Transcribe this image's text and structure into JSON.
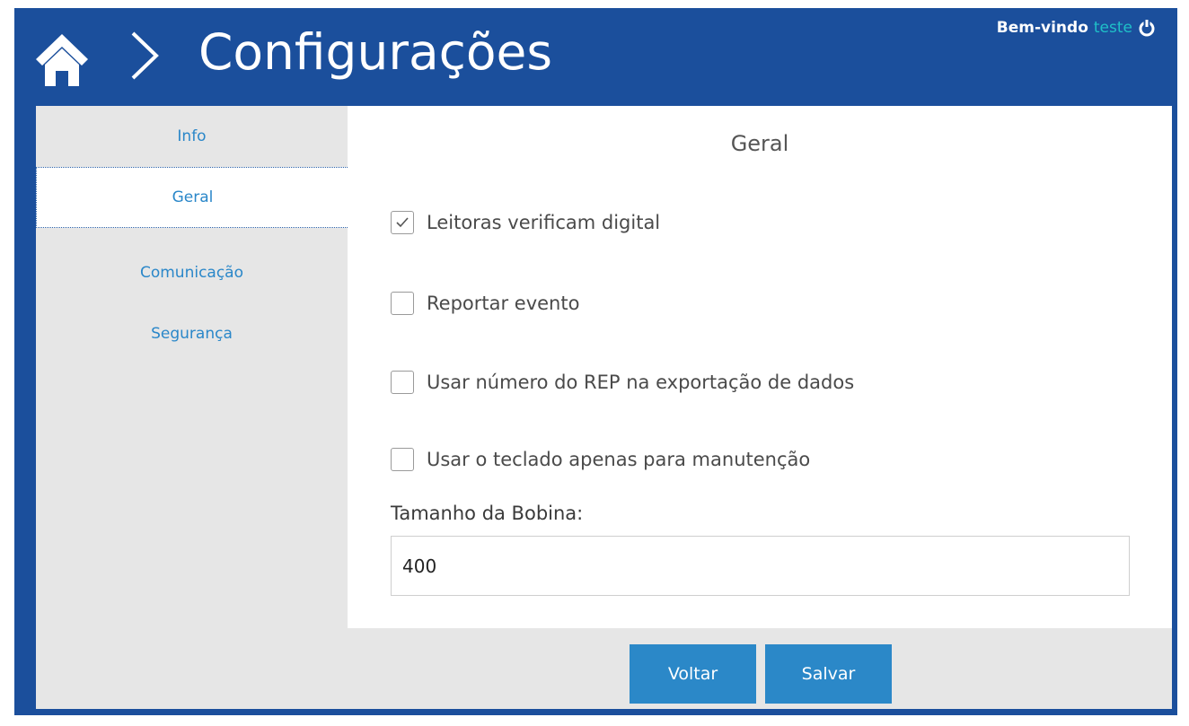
{
  "header": {
    "title": "Configurações",
    "home_icon": "home-icon",
    "separator_icon": "chevron-right-icon",
    "welcome_text": "Bem-vindo",
    "username": "teste",
    "logout_icon": "power-icon"
  },
  "sidebar": {
    "items": [
      {
        "label": "Info",
        "active": false
      },
      {
        "label": "Geral",
        "active": true
      },
      {
        "label": "Comunicação",
        "active": false
      },
      {
        "label": "Segurança",
        "active": false
      }
    ]
  },
  "main": {
    "section_title": "Geral",
    "options": [
      {
        "label": "Leitoras verificam digital",
        "checked": true
      },
      {
        "label": "Reportar evento",
        "checked": false
      },
      {
        "label": "Usar número do REP na exportação de dados",
        "checked": false
      },
      {
        "label": "Usar o teclado apenas para manutenção",
        "checked": false
      }
    ],
    "bobina": {
      "label": "Tamanho da Bobina:",
      "value": "400"
    }
  },
  "footer": {
    "back_label": "Voltar",
    "save_label": "Salvar"
  },
  "colors": {
    "header_bg": "#1b4f9c",
    "accent": "#2b88c8",
    "username": "#1fc0c8"
  }
}
